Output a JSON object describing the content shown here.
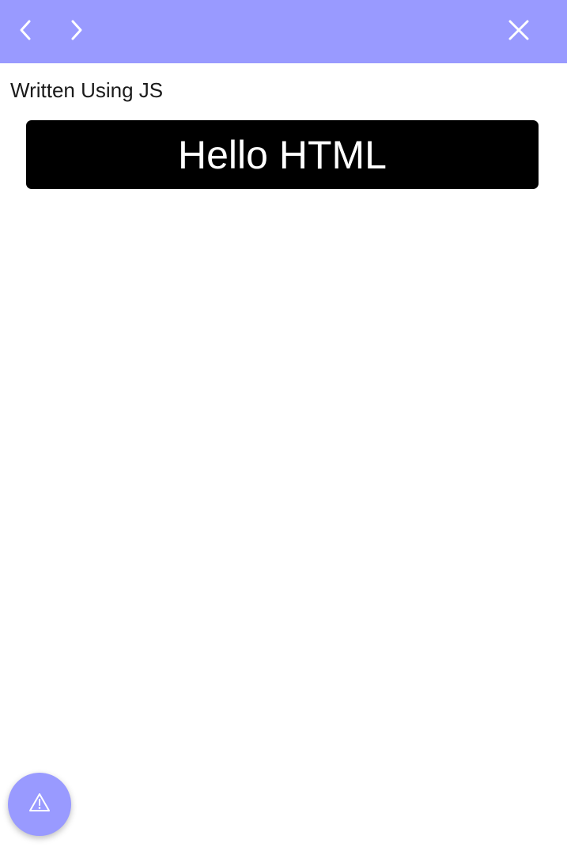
{
  "header": {
    "background_color": "#999aff",
    "back_icon": "chevron-left-icon",
    "forward_icon": "chevron-right-icon",
    "close_icon": "close-icon"
  },
  "main": {
    "subtitle": "Written Using JS",
    "hello_text": "Hello HTML",
    "hello_box_color": "#000000"
  },
  "fab": {
    "icon": "warning-icon",
    "color": "#999aff"
  }
}
